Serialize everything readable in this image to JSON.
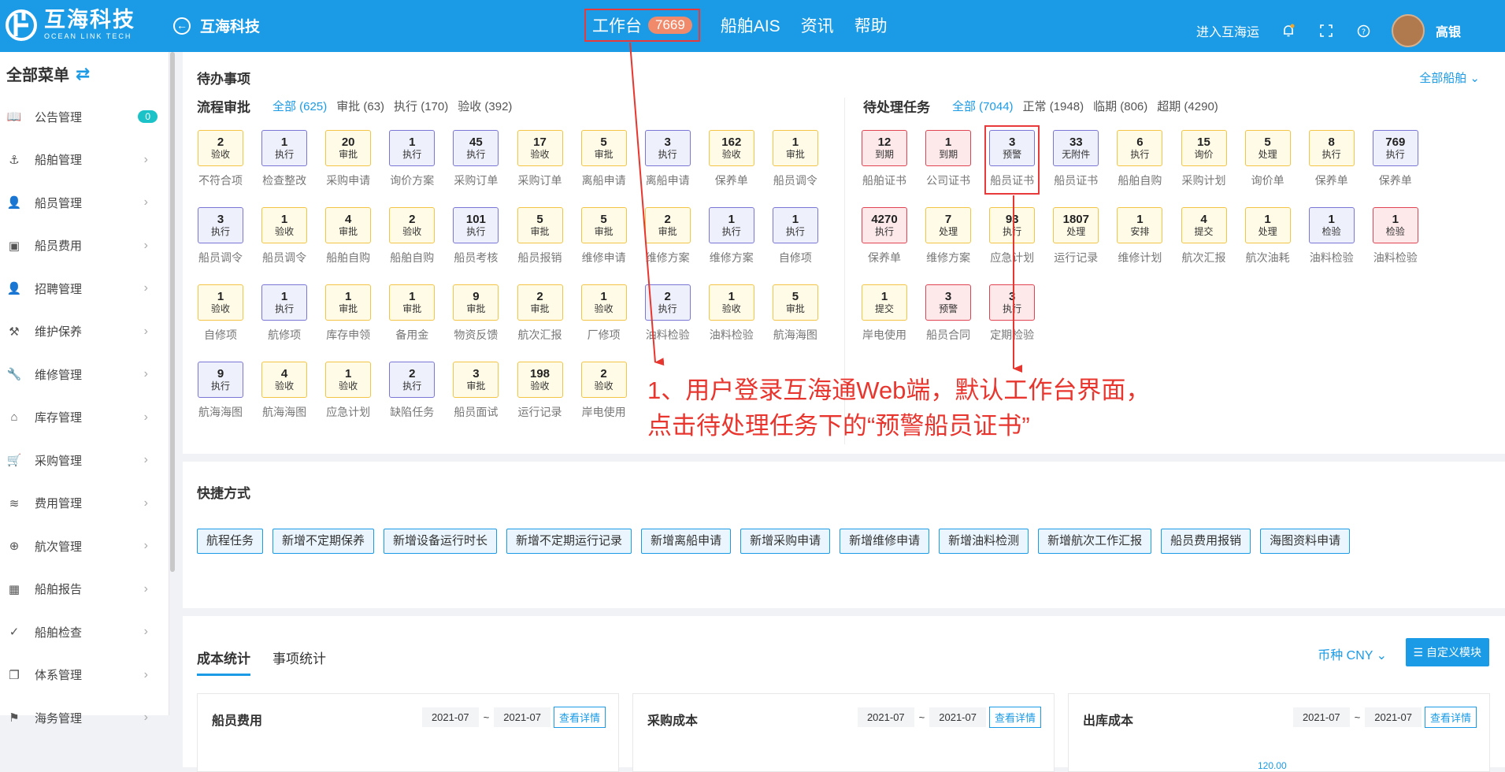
{
  "header": {
    "logo_cn": "互海科技",
    "logo_en": "OCEAN LINK TECH",
    "back_title": "互海科技",
    "nav": [
      {
        "label": "工作台",
        "badge": "7669"
      },
      {
        "label": "船舶AIS"
      },
      {
        "label": "资讯"
      },
      {
        "label": "帮助"
      }
    ],
    "enter_link": "进入互海运",
    "user": "高银"
  },
  "sidebar": {
    "title": "全部菜单",
    "items": [
      {
        "label": "公告管理",
        "icon": "book-icon",
        "badge": "0"
      },
      {
        "label": "船舶管理",
        "icon": "anchor-icon"
      },
      {
        "label": "船员管理",
        "icon": "person-icon"
      },
      {
        "label": "船员费用",
        "icon": "wallet-icon"
      },
      {
        "label": "招聘管理",
        "icon": "person-add-icon"
      },
      {
        "label": "维护保养",
        "icon": "tool-icon"
      },
      {
        "label": "维修管理",
        "icon": "wrench-icon"
      },
      {
        "label": "库存管理",
        "icon": "home-icon"
      },
      {
        "label": "采购管理",
        "icon": "cart-icon"
      },
      {
        "label": "费用管理",
        "icon": "coins-icon"
      },
      {
        "label": "航次管理",
        "icon": "globe-icon"
      },
      {
        "label": "船舶报告",
        "icon": "calendar-icon"
      },
      {
        "label": "船舶检查",
        "icon": "check-circle-icon"
      },
      {
        "label": "体系管理",
        "icon": "documents-icon"
      },
      {
        "label": "海务管理",
        "icon": "signpost-icon"
      }
    ]
  },
  "todo": {
    "title": "待办事项",
    "all_ships": "全部船舶",
    "flow": {
      "name": "流程审批",
      "filters": [
        "全部 (625)",
        "审批 (63)",
        "执行 (170)",
        "验收 (392)"
      ],
      "rows": [
        [
          {
            "n": "2",
            "t": "验收",
            "label": "不符合项",
            "c": "y"
          },
          {
            "n": "1",
            "t": "执行",
            "label": "检查整改",
            "c": "p"
          },
          {
            "n": "20",
            "t": "审批",
            "label": "采购申请",
            "c": "y"
          },
          {
            "n": "1",
            "t": "执行",
            "label": "询价方案",
            "c": "p"
          },
          {
            "n": "45",
            "t": "执行",
            "label": "采购订单",
            "c": "p"
          },
          {
            "n": "17",
            "t": "验收",
            "label": "采购订单",
            "c": "y"
          },
          {
            "n": "5",
            "t": "审批",
            "label": "离船申请",
            "c": "y"
          },
          {
            "n": "3",
            "t": "执行",
            "label": "离船申请",
            "c": "p"
          },
          {
            "n": "162",
            "t": "验收",
            "label": "保养单",
            "c": "y"
          },
          {
            "n": "1",
            "t": "审批",
            "label": "船员调令",
            "c": "y"
          }
        ],
        [
          {
            "n": "3",
            "t": "执行",
            "label": "船员调令",
            "c": "p"
          },
          {
            "n": "1",
            "t": "验收",
            "label": "船员调令",
            "c": "y"
          },
          {
            "n": "4",
            "t": "审批",
            "label": "船舶自购",
            "c": "y"
          },
          {
            "n": "2",
            "t": "验收",
            "label": "船舶自购",
            "c": "y"
          },
          {
            "n": "101",
            "t": "执行",
            "label": "船员考核",
            "c": "p"
          },
          {
            "n": "5",
            "t": "审批",
            "label": "船员报销",
            "c": "y"
          },
          {
            "n": "5",
            "t": "审批",
            "label": "维修申请",
            "c": "y"
          },
          {
            "n": "2",
            "t": "审批",
            "label": "维修方案",
            "c": "y"
          },
          {
            "n": "1",
            "t": "执行",
            "label": "维修方案",
            "c": "p"
          },
          {
            "n": "1",
            "t": "执行",
            "label": "自修项",
            "c": "p"
          }
        ],
        [
          {
            "n": "1",
            "t": "验收",
            "label": "自修项",
            "c": "y"
          },
          {
            "n": "1",
            "t": "执行",
            "label": "航修项",
            "c": "p"
          },
          {
            "n": "1",
            "t": "审批",
            "label": "库存申领",
            "c": "y"
          },
          {
            "n": "1",
            "t": "审批",
            "label": "备用金",
            "c": "y"
          },
          {
            "n": "9",
            "t": "审批",
            "label": "物资反馈",
            "c": "y"
          },
          {
            "n": "2",
            "t": "审批",
            "label": "航次汇报",
            "c": "y"
          },
          {
            "n": "1",
            "t": "验收",
            "label": "厂修项",
            "c": "y"
          },
          {
            "n": "2",
            "t": "执行",
            "label": "油料检验",
            "c": "p"
          },
          {
            "n": "1",
            "t": "验收",
            "label": "油料检验",
            "c": "y"
          },
          {
            "n": "5",
            "t": "审批",
            "label": "航海海图",
            "c": "y"
          }
        ],
        [
          {
            "n": "9",
            "t": "执行",
            "label": "航海海图",
            "c": "p"
          },
          {
            "n": "4",
            "t": "验收",
            "label": "航海海图",
            "c": "y"
          },
          {
            "n": "1",
            "t": "验收",
            "label": "应急计划",
            "c": "y"
          },
          {
            "n": "2",
            "t": "执行",
            "label": "缺陷任务",
            "c": "p"
          },
          {
            "n": "3",
            "t": "审批",
            "label": "船员面试",
            "c": "y"
          },
          {
            "n": "198",
            "t": "验收",
            "label": "运行记录",
            "c": "y"
          },
          {
            "n": "2",
            "t": "验收",
            "label": "岸电使用",
            "c": "y"
          }
        ]
      ]
    },
    "pending": {
      "name": "待处理任务",
      "filters": [
        "全部 (7044)",
        "正常 (1948)",
        "临期 (806)",
        "超期 (4290)"
      ],
      "rows": [
        [
          {
            "n": "12",
            "t": "到期",
            "label": "船舶证书",
            "c": "r"
          },
          {
            "n": "1",
            "t": "到期",
            "label": "公司证书",
            "c": "r"
          },
          {
            "n": "3",
            "t": "预警",
            "label": "船员证书",
            "c": "p"
          },
          {
            "n": "33",
            "t": "无附件",
            "label": "船员证书",
            "c": "p"
          },
          {
            "n": "6",
            "t": "执行",
            "label": "船舶自购",
            "c": "y"
          },
          {
            "n": "15",
            "t": "询价",
            "label": "采购计划",
            "c": "y"
          },
          {
            "n": "5",
            "t": "处理",
            "label": "询价单",
            "c": "y"
          },
          {
            "n": "8",
            "t": "执行",
            "label": "保养单",
            "c": "y"
          },
          {
            "n": "769",
            "t": "执行",
            "label": "保养单",
            "c": "p"
          }
        ],
        [
          {
            "n": "4270",
            "t": "执行",
            "label": "保养单",
            "c": "r"
          },
          {
            "n": "7",
            "t": "处理",
            "label": "维修方案",
            "c": "y"
          },
          {
            "n": "93",
            "t": "执行",
            "label": "应急计划",
            "c": "y"
          },
          {
            "n": "1807",
            "t": "处理",
            "label": "运行记录",
            "c": "y"
          },
          {
            "n": "1",
            "t": "安排",
            "label": "维修计划",
            "c": "y"
          },
          {
            "n": "4",
            "t": "提交",
            "label": "航次汇报",
            "c": "y"
          },
          {
            "n": "1",
            "t": "处理",
            "label": "航次油耗",
            "c": "y"
          },
          {
            "n": "1",
            "t": "检验",
            "label": "油料检验",
            "c": "p"
          },
          {
            "n": "1",
            "t": "检验",
            "label": "油料检验",
            "c": "r"
          }
        ],
        [
          {
            "n": "1",
            "t": "提交",
            "label": "岸电使用",
            "c": "y"
          },
          {
            "n": "3",
            "t": "预警",
            "label": "船员合同",
            "c": "r"
          },
          {
            "n": "3",
            "t": "执行",
            "label": "定期检验",
            "c": "r"
          }
        ]
      ]
    }
  },
  "annotation": {
    "line1": "1、用户登录互海通Web端，默认工作台界面，",
    "line2": "点击待处理任务下的“预警船员证书”"
  },
  "quick": {
    "title": "快捷方式",
    "buttons": [
      "航程任务",
      "新增不定期保养",
      "新增设备运行时长",
      "新增不定期运行记录",
      "新增离船申请",
      "新增采购申请",
      "新增维修申请",
      "新增油料检测",
      "新增航次工作汇报",
      "船员费用报销",
      "海图资料申请"
    ]
  },
  "stats": {
    "tabs": [
      "成本统计",
      "事项统计"
    ],
    "currency": "币种 CNY",
    "customize": "自定义模块",
    "cards": [
      {
        "name": "船员费用",
        "from": "2021-07",
        "to": "2021-07",
        "detail": "查看详情"
      },
      {
        "name": "采购成本",
        "from": "2021-07",
        "to": "2021-07",
        "detail": "查看详情"
      },
      {
        "name": "出库成本",
        "from": "2021-07",
        "to": "2021-07",
        "detail": "查看详情"
      }
    ],
    "partial_tick": "120.00"
  }
}
